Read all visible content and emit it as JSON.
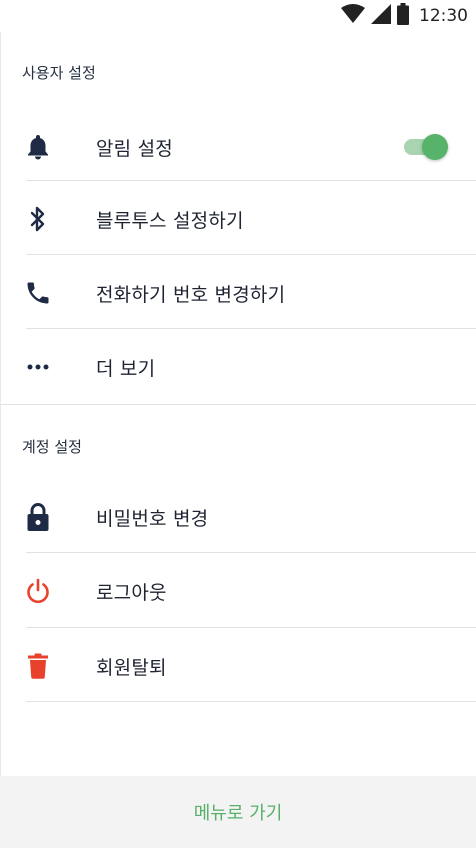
{
  "status_bar": {
    "time": "12:30",
    "icons": [
      "wifi-icon",
      "signal-icon",
      "battery-icon"
    ]
  },
  "sections": {
    "user": {
      "title": "사용자 설정",
      "items": [
        {
          "label": "알림 설정",
          "icon": "bell-icon"
        },
        {
          "label": "블루투스 설정하기",
          "icon": "bluetooth-icon"
        },
        {
          "label": "전화하기 번호 변경하기",
          "icon": "phone-icon"
        },
        {
          "label": "더 보기",
          "icon": "more-dots-icon"
        }
      ],
      "notification_toggle_on": true
    },
    "account": {
      "title": "계정 설정",
      "items": [
        {
          "label": "비밀번호 변경",
          "icon": "lock-icon"
        },
        {
          "label": "로그아웃",
          "icon": "power-icon"
        },
        {
          "label": "회원탈퇴",
          "icon": "trash-icon"
        }
      ]
    }
  },
  "footer": {
    "label": "메뉴로 가기"
  },
  "colors": {
    "accent_green": "#57b26a",
    "toggle_track": "#a9d4b0",
    "danger_red": "#e8412c",
    "icon_dark": "#1f2a44",
    "footer_bg": "#f3f3f3"
  }
}
